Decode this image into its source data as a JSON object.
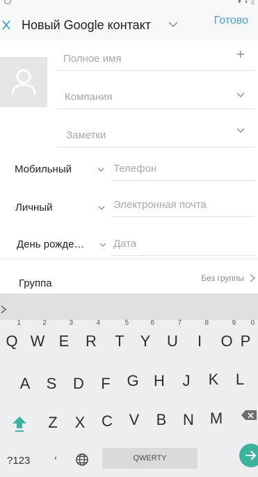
{
  "header": {
    "title": "Новый Google контакт",
    "done_label": "Готово"
  },
  "form": {
    "full_name_placeholder": "Полное имя",
    "company_placeholder": "Компания",
    "notes_placeholder": "Заметки",
    "phone": {
      "type_label": "Мобильный",
      "placeholder": "Телефон"
    },
    "email": {
      "type_label": "Личный",
      "placeholder": "Электронная почта"
    },
    "date": {
      "type_label": "День рожде…",
      "placeholder": "Дата"
    },
    "group": {
      "label": "Группа",
      "value": "Без группы"
    }
  },
  "keyboard": {
    "row1": [
      {
        "key": "Q",
        "hint": "1"
      },
      {
        "key": "W",
        "hint": "2"
      },
      {
        "key": "E",
        "hint": "3"
      },
      {
        "key": "R",
        "hint": "4"
      },
      {
        "key": "T",
        "hint": "5"
      },
      {
        "key": "Y",
        "hint": "6"
      },
      {
        "key": "U",
        "hint": "7"
      },
      {
        "key": "I",
        "hint": "8"
      },
      {
        "key": "O",
        "hint": "9"
      },
      {
        "key": "P",
        "hint": "0"
      }
    ],
    "row2": [
      "A",
      "S",
      "D",
      "F",
      "G",
      "H",
      "J",
      "K",
      "L"
    ],
    "row3": [
      "Z",
      "X",
      "C",
      "V",
      "B",
      "N",
      "M"
    ],
    "symbols_label": "?123",
    "comma_label": ",",
    "space_label": "QWERTY",
    "accent_color": "#3fb29f"
  },
  "colors": {
    "accent": "#4aa0d6",
    "placeholder": "#a6a8ab",
    "avatar_bg": "#e4e5e7"
  },
  "icons": {
    "close": "close-icon",
    "chevron": "chevron-down-icon",
    "plus": "plus-icon",
    "avatar": "person-icon",
    "shift": "shift-icon",
    "backspace": "backspace-icon",
    "globe": "globe-icon",
    "enter": "arrow-right-icon"
  }
}
